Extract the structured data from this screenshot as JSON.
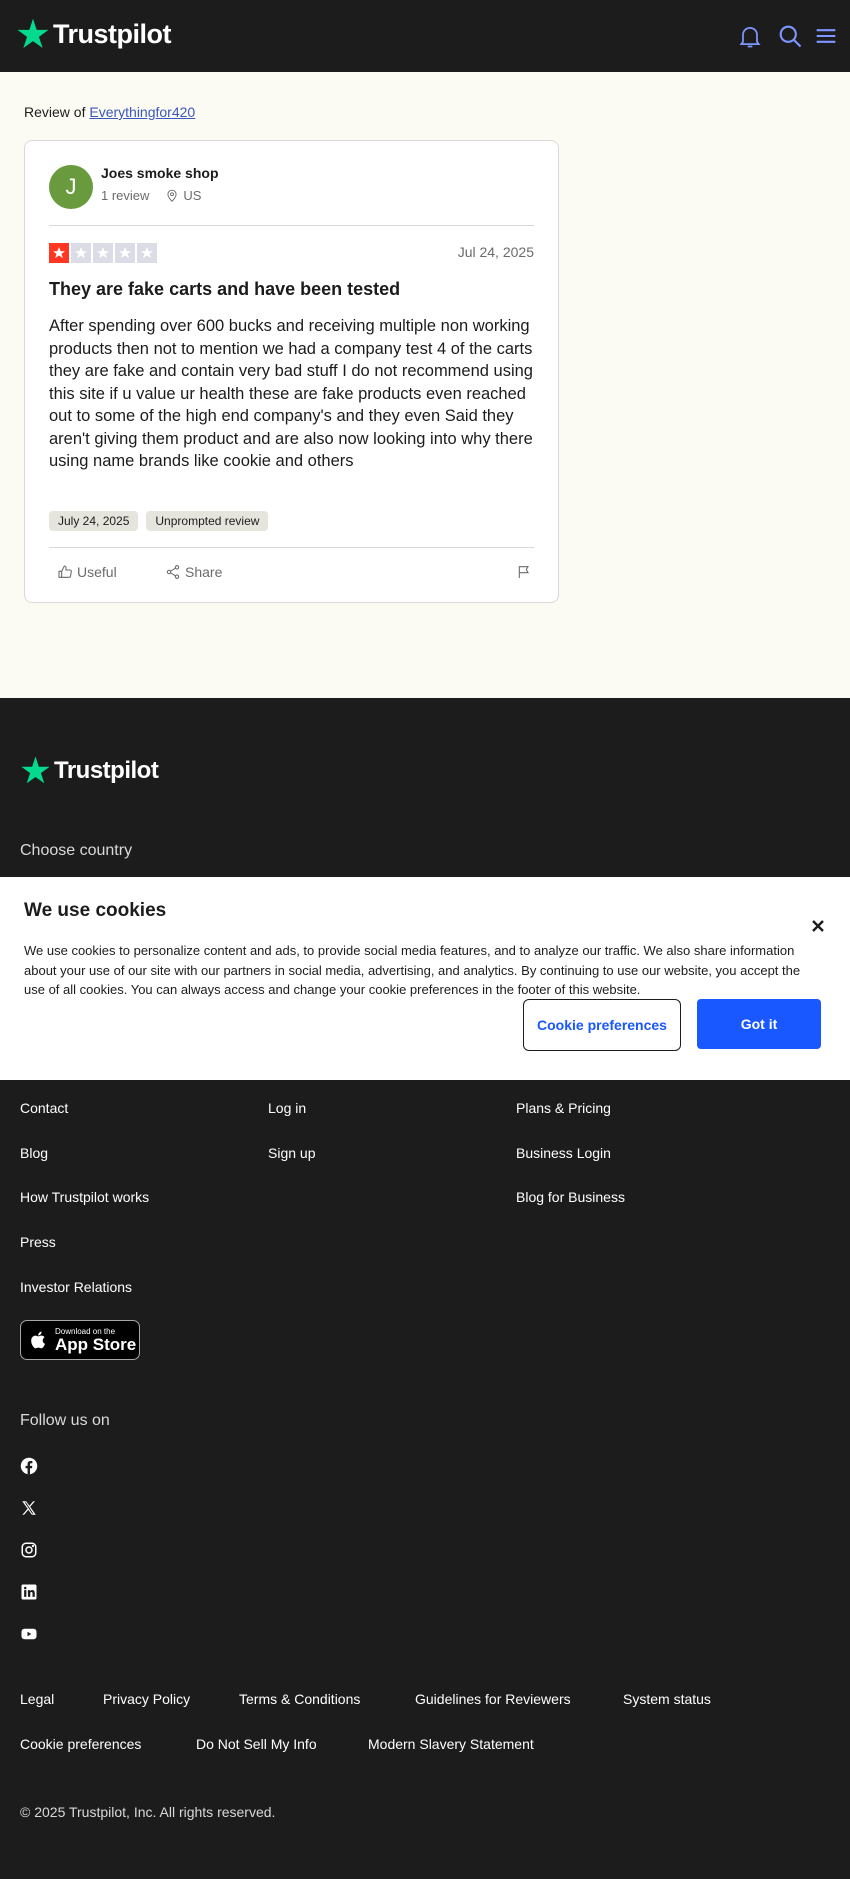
{
  "header": {
    "brand": "Trustpilot",
    "icons": [
      "bell-icon",
      "search-icon",
      "menu-icon"
    ]
  },
  "review_of": {
    "prefix": "Review of",
    "company": "Everythingfor420"
  },
  "review": {
    "avatar_letter": "J",
    "avatar_color": "#6a9a3e",
    "reviewer_name": "Joes smoke shop",
    "review_count": "1 review",
    "country": "US",
    "rating": 1,
    "rating_max": 5,
    "date": "Jul 24, 2025",
    "title": "They are fake carts and have been tested",
    "body": "After spending over 600 bucks and receiving multiple non working products then not to mention we had a company test 4 of the carts they are fake and contain very bad stuff I do not recommend using this site if u value ur health these are fake products even reached out to some of the high end company's and they even Said they aren't giving them product and are also now looking into why there using name brands like cookie and others",
    "tags": [
      "July 24, 2025",
      "Unprompted review"
    ],
    "actions": {
      "useful": "Useful",
      "share": "Share"
    }
  },
  "footer": {
    "brand": "Trustpilot",
    "choose_country": "Choose country",
    "col1": [
      "Contact",
      "Blog",
      "How Trustpilot works",
      "Press",
      "Investor Relations"
    ],
    "col2": [
      "Log in",
      "Sign up"
    ],
    "col3": [
      "Plans & Pricing",
      "Business Login",
      "Blog for Business"
    ],
    "app_store": {
      "small": "Download on the",
      "big": "App Store"
    },
    "follow_us": "Follow us on",
    "social_icons": [
      "facebook-icon",
      "x-icon",
      "instagram-icon",
      "linkedin-icon",
      "youtube-icon"
    ],
    "legal_row1": [
      "Legal",
      "Privacy Policy",
      "Terms & Conditions",
      "Guidelines for Reviewers",
      "System status"
    ],
    "legal_row2": [
      "Cookie preferences",
      "Do Not Sell My Info",
      "Modern Slavery Statement"
    ],
    "copyright": "© 2025 Trustpilot, Inc. All rights reserved."
  },
  "cookie_banner": {
    "title": "We use cookies",
    "text": "We use cookies to personalize content and ads, to provide social media features, and to analyze our traffic. We also share information about your use of our site with our partners in social media, advertising, and analytics. By continuing to use our website, you accept the use of all cookies. You can always access and change your cookie preferences in the footer of this website.",
    "preferences_button": "Cookie preferences",
    "accept_button": "Got it"
  },
  "colors": {
    "header_bg": "#1c1c1c",
    "page_bg": "#fcfbf3",
    "brand_green": "#04da8d",
    "star_red": "#ff3722",
    "star_empty": "#dcdce6",
    "link_blue": "#3c57bc",
    "button_blue": "#1957ff"
  }
}
